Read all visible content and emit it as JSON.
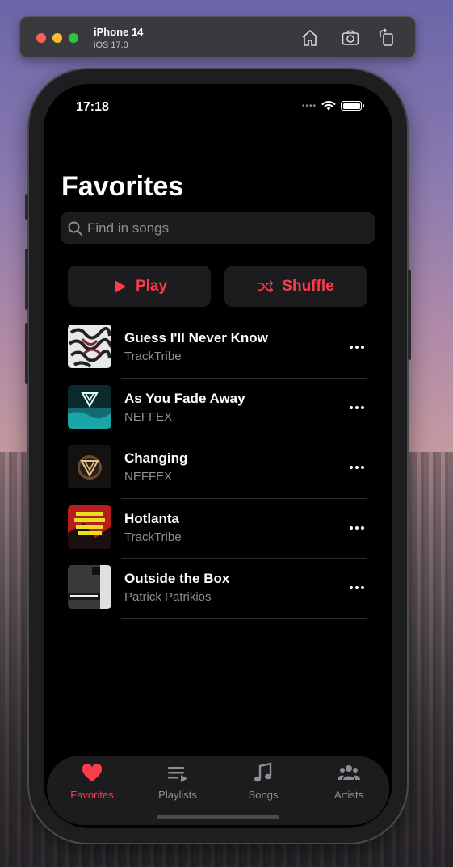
{
  "simulator": {
    "device": "iPhone 14",
    "os": "iOS 17.0",
    "icons": [
      "home-icon",
      "camera-icon",
      "rotate-icon"
    ]
  },
  "status": {
    "time": "17:18"
  },
  "page": {
    "title": "Favorites",
    "search_placeholder": "Find in songs",
    "play_label": "Play",
    "shuffle_label": "Shuffle"
  },
  "songs": [
    {
      "title": "Guess I'll Never Know",
      "artist": "TrackTribe"
    },
    {
      "title": "As You Fade Away",
      "artist": "NEFFEX"
    },
    {
      "title": "Changing",
      "artist": "NEFFEX"
    },
    {
      "title": "Hotlanta",
      "artist": "TrackTribe"
    },
    {
      "title": "Outside the Box",
      "artist": "Patrick Patrikios"
    }
  ],
  "tabs": [
    {
      "label": "Favorites",
      "icon": "heart-icon",
      "active": true
    },
    {
      "label": "Playlists",
      "icon": "playlist-icon",
      "active": false
    },
    {
      "label": "Songs",
      "icon": "music-note-icon",
      "active": false
    },
    {
      "label": "Artists",
      "icon": "people-icon",
      "active": false
    }
  ],
  "colors": {
    "accent": "#fa3c4c",
    "background": "#000000",
    "surface": "#1c1c1e",
    "secondary_text": "#8e8e93"
  }
}
